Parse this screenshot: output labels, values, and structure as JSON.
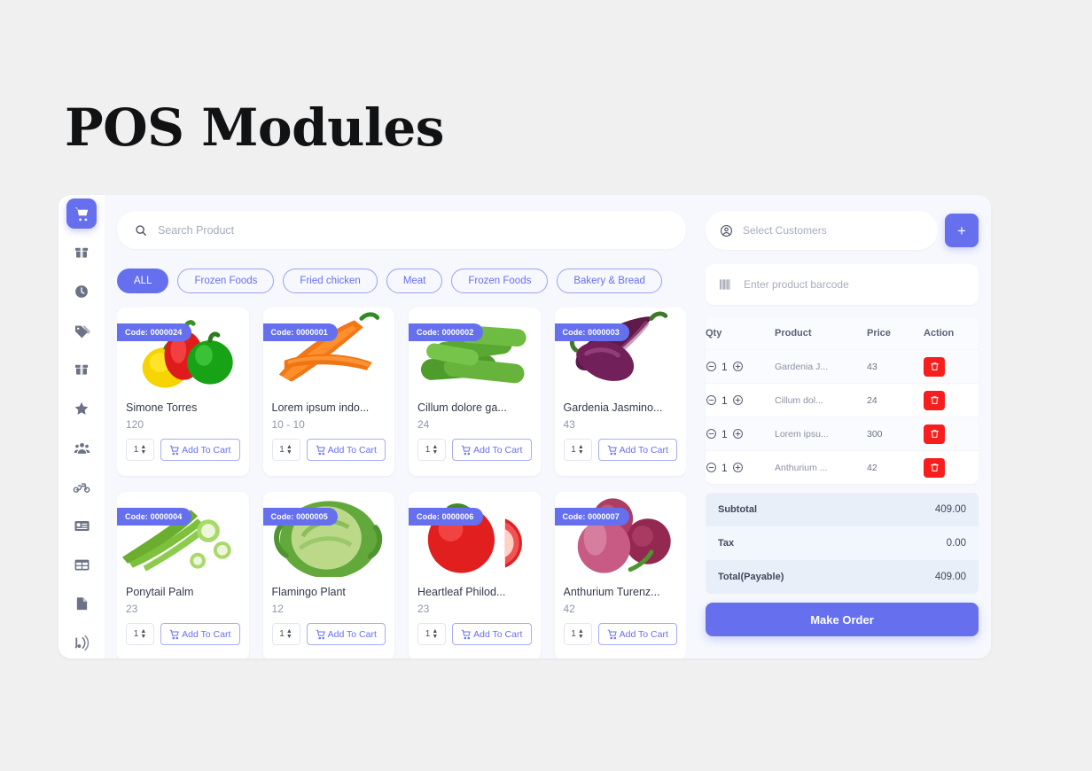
{
  "page": {
    "title": "POS Modules"
  },
  "sidebar": {
    "items": [
      {
        "icon": "shopping-cart-icon",
        "name": "pos",
        "active": true
      },
      {
        "icon": "box-icon",
        "name": "products",
        "active": false
      },
      {
        "icon": "clock-icon",
        "name": "history",
        "active": false
      },
      {
        "icon": "tags-icon",
        "name": "tags",
        "active": false
      },
      {
        "icon": "box-icon",
        "name": "inventory",
        "active": false
      },
      {
        "icon": "star-icon",
        "name": "favorites",
        "active": false
      },
      {
        "icon": "users-icon",
        "name": "customers",
        "active": false
      },
      {
        "icon": "motorbike-icon",
        "name": "delivery",
        "active": false
      },
      {
        "icon": "id-card-icon",
        "name": "accounts",
        "active": false
      },
      {
        "icon": "table-icon",
        "name": "tables",
        "active": false
      },
      {
        "icon": "document-icon",
        "name": "reports",
        "active": false
      },
      {
        "icon": "broadcast-icon",
        "name": "broadcast",
        "active": false
      }
    ]
  },
  "search": {
    "placeholder": "Search Product",
    "value": "",
    "icon": "search-icon"
  },
  "categories": [
    {
      "label": "ALL",
      "active": true
    },
    {
      "label": "Frozen Foods",
      "active": false
    },
    {
      "label": "Fried chicken",
      "active": false
    },
    {
      "label": "Meat",
      "active": false
    },
    {
      "label": "Frozen Foods",
      "active": false
    },
    {
      "label": "Bakery & Bread",
      "active": false
    }
  ],
  "products": [
    {
      "code": "Code: 0000024",
      "name": "Simone Torres",
      "price": "120",
      "qty": "1",
      "add_label": "Add To Cart",
      "image": "bell-peppers"
    },
    {
      "code": "Code: 0000001",
      "name": "Lorem ipsum indo...",
      "price": "10 - 10",
      "qty": "1",
      "add_label": "Add To Cart",
      "image": "carrots"
    },
    {
      "code": "Code: 0000002",
      "name": "Cillum dolore ga...",
      "price": "24",
      "qty": "1",
      "add_label": "Add To Cart",
      "image": "cucumbers"
    },
    {
      "code": "Code: 0000003",
      "name": "Gardenia Jasmino...",
      "price": "43",
      "qty": "1",
      "add_label": "Add To Cart",
      "image": "eggplants"
    },
    {
      "code": "Code: 0000004",
      "name": "Ponytail Palm",
      "price": "23",
      "qty": "1",
      "add_label": "Add To Cart",
      "image": "okra"
    },
    {
      "code": "Code: 0000005",
      "name": "Flamingo Plant",
      "price": "12",
      "qty": "1",
      "add_label": "Add To Cart",
      "image": "cabbage"
    },
    {
      "code": "Code: 0000006",
      "name": "Heartleaf Philod...",
      "price": "23",
      "qty": "1",
      "add_label": "Add To Cart",
      "image": "tomatoes"
    },
    {
      "code": "Code: 0000007",
      "name": "Anthurium Turenz...",
      "price": "42",
      "qty": "1",
      "add_label": "Add To Cart",
      "image": "onions"
    }
  ],
  "cart": {
    "customer": {
      "placeholder": "Select Customers",
      "value": "",
      "icon": "user-circle-icon"
    },
    "add_customer_label": "+",
    "barcode": {
      "placeholder": "Enter product barcode",
      "value": "",
      "icon": "barcode-icon"
    },
    "columns": [
      "Qty",
      "Product",
      "Price",
      "Action"
    ],
    "rows": [
      {
        "qty": "1",
        "product": "Gardenia J...",
        "price": "43"
      },
      {
        "qty": "1",
        "product": "Cillum dol...",
        "price": "24"
      },
      {
        "qty": "1",
        "product": "Lorem ipsu...",
        "price": "300"
      },
      {
        "qty": "1",
        "product": "Anthurium ...",
        "price": "42"
      }
    ],
    "totals": [
      {
        "label": "Subtotal",
        "value": "409.00"
      },
      {
        "label": "Tax",
        "value": "0.00"
      },
      {
        "label": "Total(Payable)",
        "value": "409.00"
      }
    ],
    "make_order_label": "Make Order"
  },
  "colors": {
    "accent": "#6670ee",
    "danger": "#f81e1e",
    "page_bg": "#f0f0f0",
    "panel_bg": "#f6f8fd",
    "card_bg": "#ffffff"
  }
}
